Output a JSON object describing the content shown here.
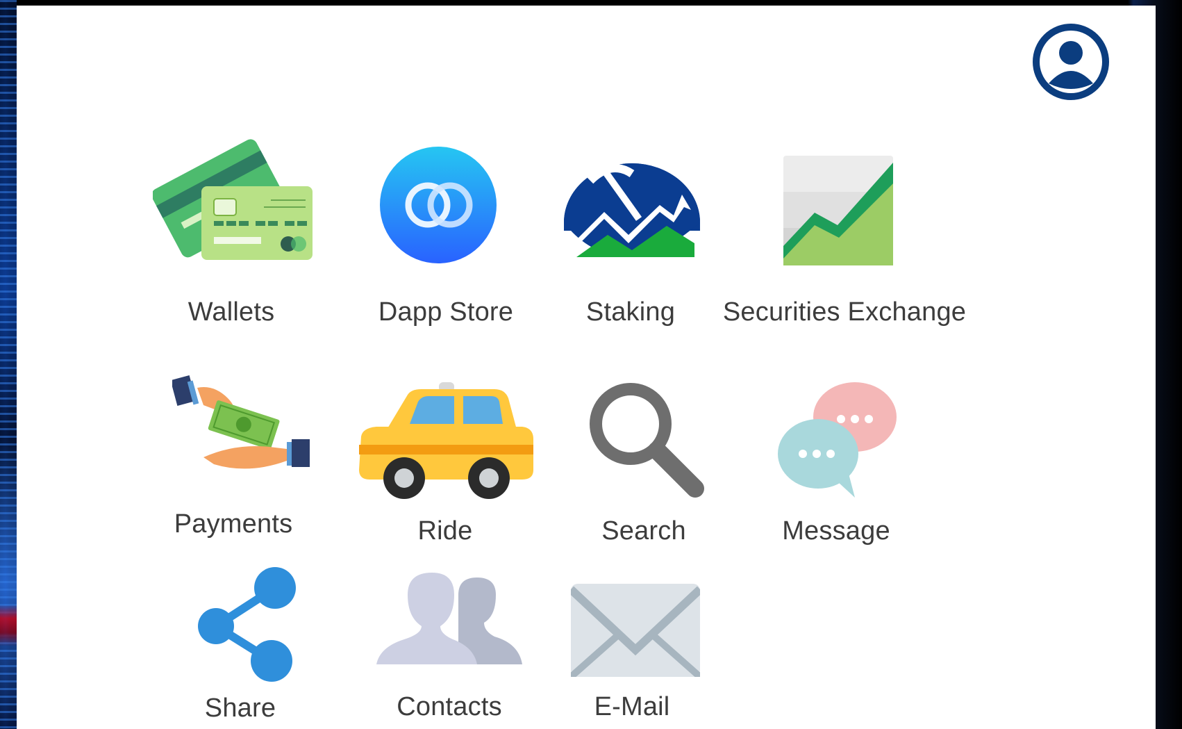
{
  "header": {
    "profile_icon": "user-circle-icon",
    "accent": "#0b3d7f"
  },
  "apps": [
    {
      "label": "Wallets",
      "icon": "credit-cards-icon"
    },
    {
      "label": "Dapp Store",
      "icon": "dapp-store-icon"
    },
    {
      "label": "Staking",
      "icon": "pickaxe-mountain-icon"
    },
    {
      "label": "Securities Exchange",
      "icon": "chart-up-icon"
    },
    {
      "label": "Payments",
      "icon": "cash-hand-icon"
    },
    {
      "label": "Ride",
      "icon": "taxi-icon"
    },
    {
      "label": "Search",
      "icon": "magnifier-icon"
    },
    {
      "label": "Message",
      "icon": "chat-bubbles-icon"
    },
    {
      "label": "Share",
      "icon": "share-icon"
    },
    {
      "label": "Contacts",
      "icon": "contacts-icon"
    },
    {
      "label": "E-Mail",
      "icon": "envelope-icon"
    }
  ]
}
